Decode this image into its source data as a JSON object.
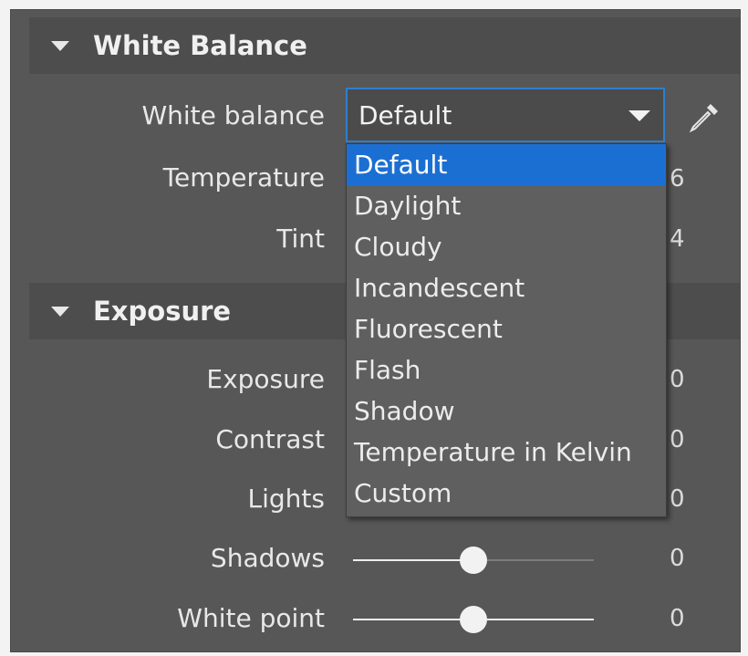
{
  "white_balance_section": {
    "title": "White Balance",
    "white_balance_label": "White balance",
    "selected": "Default",
    "options": [
      "Default",
      "Daylight",
      "Cloudy",
      "Incandescent",
      "Fluorescent",
      "Flash",
      "Shadow",
      "Temperature in Kelvin",
      "Custom"
    ],
    "temperature": {
      "label": "Temperature",
      "value": "6"
    },
    "tint": {
      "label": "Tint",
      "value": "4"
    }
  },
  "exposure_section": {
    "title": "Exposure",
    "exposure": {
      "label": "Exposure",
      "value": "0"
    },
    "contrast": {
      "label": "Contrast",
      "value": "0"
    },
    "lights": {
      "label": "Lights",
      "value": "0"
    },
    "shadows": {
      "label": "Shadows",
      "value": "0",
      "slider_fraction": 0.5
    },
    "white_point": {
      "label": "White point",
      "value": "0",
      "slider_fraction": 0.5
    }
  },
  "icons": {
    "collapse": "triangle-down-icon",
    "dropdown": "chevron-down-icon",
    "picker": "eyedropper-icon"
  },
  "colors": {
    "panel_bg": "#575757",
    "header_bg": "#4d4d4d",
    "accent": "#1c6fd2",
    "select_border": "#2d7fd1"
  }
}
